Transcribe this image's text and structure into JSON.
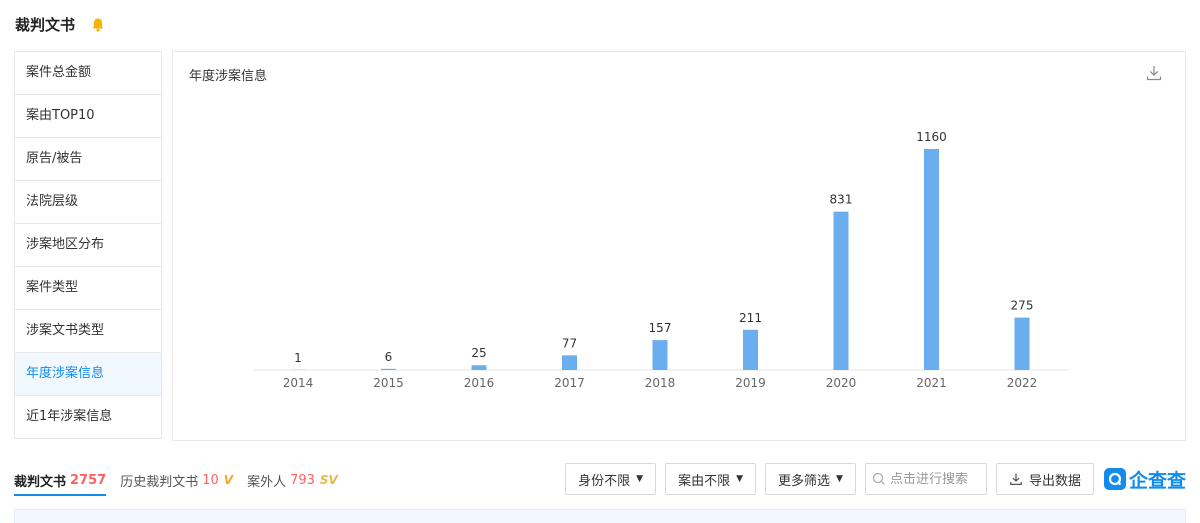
{
  "header": {
    "title": "裁判文书",
    "icon": "bell-icon"
  },
  "sidebar": {
    "items": [
      {
        "label": "案件总金额",
        "active": false
      },
      {
        "label": "案由TOP10",
        "active": false
      },
      {
        "label": "原告/被告",
        "active": false
      },
      {
        "label": "法院层级",
        "active": false
      },
      {
        "label": "涉案地区分布",
        "active": false
      },
      {
        "label": "案件类型",
        "active": false
      },
      {
        "label": "涉案文书类型",
        "active": false
      },
      {
        "label": "年度涉案信息",
        "active": true
      },
      {
        "label": "近1年涉案信息",
        "active": false
      }
    ]
  },
  "panel": {
    "title": "年度涉案信息",
    "download_icon": "download-icon"
  },
  "chart_data": {
    "type": "bar",
    "categories": [
      "2014",
      "2015",
      "2016",
      "2017",
      "2018",
      "2019",
      "2020",
      "2021",
      "2022"
    ],
    "values": [
      1,
      6,
      25,
      77,
      157,
      211,
      831,
      1160,
      275
    ],
    "title": "",
    "xlabel": "",
    "ylabel": "",
    "ylim": [
      0,
      1160
    ],
    "grid": false,
    "data_labels": true,
    "bar_color": "#6aaef0"
  },
  "tabs": [
    {
      "label": "裁判文书",
      "count": "2757",
      "active": true,
      "badge": ""
    },
    {
      "label": "历史裁判文书",
      "count": "10",
      "active": false,
      "badge": "V"
    },
    {
      "label": "案外人",
      "count": "793",
      "active": false,
      "badge": "SV"
    }
  ],
  "filters": {
    "identity": "身份不限",
    "cause": "案由不限",
    "more": "更多筛选",
    "search_placeholder": "点击进行搜索",
    "export": "导出数据"
  },
  "brand": {
    "name": "企查查"
  },
  "colors": {
    "accent": "#128bed",
    "count": "#ff6060",
    "bar": "#6aaef0"
  }
}
